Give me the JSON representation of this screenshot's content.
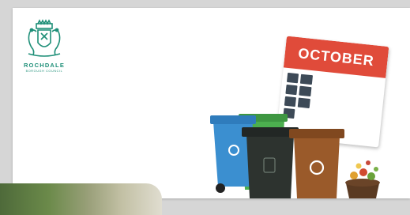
{
  "logo": {
    "name": "ROCHDALE",
    "subtitle": "BOROUGH COUNCIL",
    "color": "#1e8f78",
    "icon": "coat-of-arms-icon"
  },
  "calendar": {
    "month": "OCTOBER",
    "header_color": "#e04b3a",
    "icon": "calendar-icon"
  },
  "bins": [
    {
      "name": "blue-bin",
      "color": "#3b8fd0",
      "icon": "recycle-icon"
    },
    {
      "name": "green-bin",
      "color": "#4caf4f",
      "icon": "recycle-icon"
    },
    {
      "name": "black-bin",
      "color": "#2d332f",
      "icon": "coat-of-arms-icon"
    },
    {
      "name": "brown-bin",
      "color": "#9a5a2a",
      "icon": "recycle-icon"
    }
  ],
  "food_caddy": {
    "icon": "food-waste-icon"
  },
  "photo": {
    "icon": "garden-photo"
  }
}
